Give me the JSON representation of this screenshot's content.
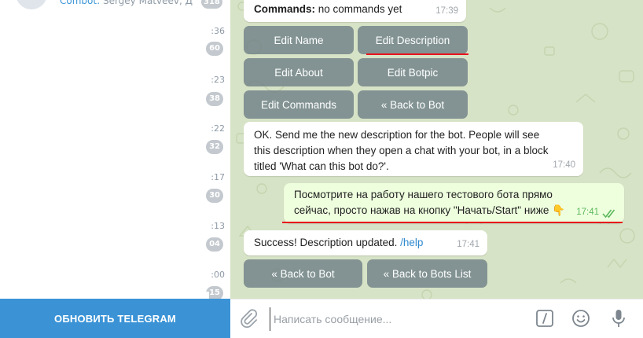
{
  "sidebar": {
    "top_chat": {
      "preview_sender": "Combot:",
      "preview_text": "Sergey Matveev, Д...",
      "badge": "318"
    },
    "items": [
      {
        "time": ":36",
        "badge": "60"
      },
      {
        "time": ":23",
        "badge": "38"
      },
      {
        "time": ":22",
        "badge": "32"
      },
      {
        "time": ":17",
        "badge": "30"
      },
      {
        "time": ":13",
        "badge": "04"
      },
      {
        "time": ":00",
        "badge": "15"
      }
    ],
    "update_button": "ОБНОВИТЬ TELEGRAM"
  },
  "chat": {
    "commands_message": {
      "label": "Commands:",
      "text": "no commands yet",
      "time": "17:39"
    },
    "keyboard1": [
      [
        "Edit Name",
        "Edit Description"
      ],
      [
        "Edit About",
        "Edit Botpic"
      ],
      [
        "Edit Commands",
        "« Back to Bot"
      ]
    ],
    "bot_prompt": {
      "text": "OK. Send me the new description for the bot. People will see this description when they open a chat with your bot, in a block titled 'What can this bot do?'.",
      "time": "17:40"
    },
    "user_message": {
      "text": "Посмотрите на работу нашего тестового бота прямо сейчас, просто нажав на кнопку \"Начать/Start\" ниже 👇",
      "time": "17:41"
    },
    "success_message": {
      "text": "Success! Description updated.",
      "link": "/help",
      "time": "17:41"
    },
    "keyboard2": [
      "« Back to Bot",
      "« Back to Bots List"
    ]
  },
  "composer": {
    "placeholder": "Написать сообщение...",
    "icons": [
      "paperclip-icon",
      "slash-commands-icon",
      "emoji-icon",
      "microphone-icon"
    ]
  },
  "colors": {
    "accent": "#3b93d6",
    "chat_bg": "#d7e3c6",
    "outgoing_bubble": "#eeffde",
    "highlight": "#e8141c"
  }
}
